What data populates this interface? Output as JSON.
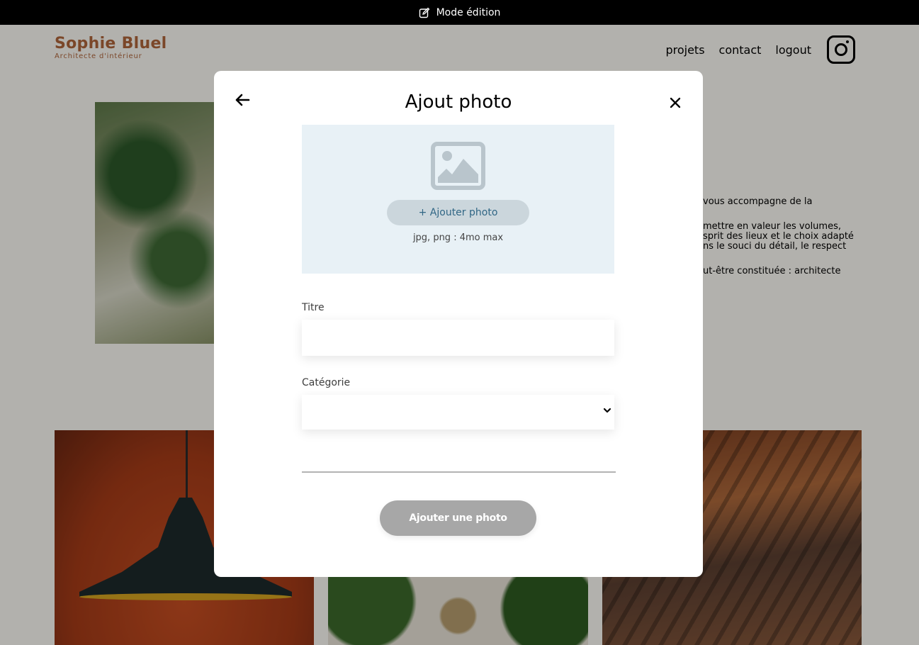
{
  "edit_banner": {
    "label": "Mode édition",
    "icon": "pen-square-icon"
  },
  "header": {
    "logo_name": "Sophie Bluel",
    "logo_subtitle": "Architecte d'intérieur",
    "nav": [
      "projets",
      "contact",
      "logout"
    ],
    "social_icon": "instagram-icon"
  },
  "intro": {
    "paragraphs": [
      "vous accompagne de la",
      "mettre en valeur les volumes,\nsprit des lieux et le choix adapté\nns le souci du détail, le respect",
      "ut-être constituée : architecte"
    ]
  },
  "modal": {
    "title": "Ajout photo",
    "back_icon": "arrow-left-icon",
    "close_icon": "close-icon",
    "upload": {
      "placeholder_icon": "image-icon",
      "button_label": "+ Ajouter photo",
      "hint": "jpg, png : 4mo max"
    },
    "fields": {
      "title_label": "Titre",
      "title_value": "",
      "category_label": "Catégorie",
      "category_value": ""
    },
    "submit_label": "Ajouter une photo"
  },
  "colors": {
    "brand": "#b1663c",
    "upload_bg": "#e8f1f6",
    "upload_button_bg": "#cbd6dc",
    "upload_button_text": "#306685",
    "submit_disabled": "#a7a7a7"
  }
}
